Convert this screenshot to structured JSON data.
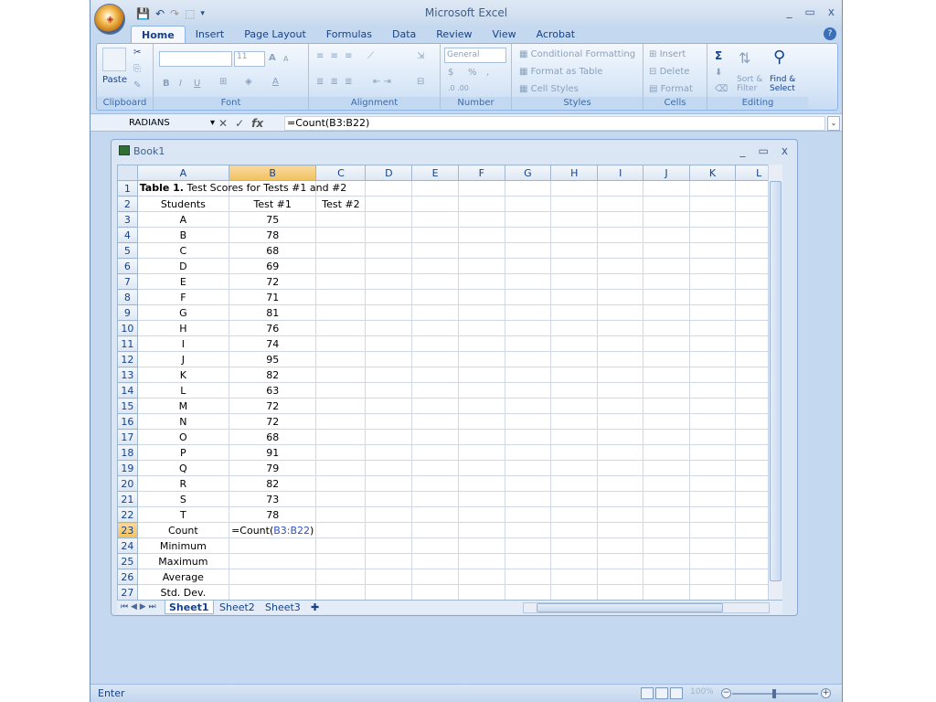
{
  "app": {
    "title": "Microsoft Excel",
    "office_button": "office-button",
    "window_controls": [
      "_",
      "▭",
      "x"
    ]
  },
  "tabs": [
    "Home",
    "Insert",
    "Page Layout",
    "Formulas",
    "Data",
    "Review",
    "View",
    "Acrobat"
  ],
  "active_tab": "Home",
  "ribbon": {
    "clipboard": {
      "label": "Clipboard",
      "paste": "Paste"
    },
    "font": {
      "label": "Font",
      "font_name": "",
      "font_size": "11",
      "grow": "A",
      "shrink": "A",
      "bold": "B",
      "italic": "I",
      "underline": "U"
    },
    "alignment": {
      "label": "Alignment"
    },
    "number": {
      "label": "Number",
      "format": "General",
      "currency": "$",
      "percent": "%",
      "comma": ","
    },
    "styles": {
      "label": "Styles",
      "conditional": "Conditional Formatting",
      "format_table": "Format as Table",
      "cell_styles": "Cell Styles"
    },
    "cells": {
      "label": "Cells",
      "insert": "Insert",
      "delete": "Delete",
      "format": "Format"
    },
    "editing": {
      "label": "Editing",
      "sigma": "Σ",
      "sort": "Sort &",
      "filter": "Filter",
      "find": "Find &",
      "select": "Select"
    }
  },
  "formula_bar": {
    "name_box": "RADIANS",
    "formula": "=Count(B3:B22)",
    "fx": "fx"
  },
  "workbook": {
    "title": "Book1",
    "controls": [
      "_",
      "▭",
      "x"
    ]
  },
  "columns": [
    "A",
    "B",
    "C",
    "D",
    "E",
    "F",
    "G",
    "H",
    "I",
    "J",
    "K",
    "L"
  ],
  "active_column": "B",
  "active_row": 23,
  "title_row": {
    "bold": "Table 1.",
    "rest": " Test Scores for Tests #1 and #2"
  },
  "headers": {
    "students": "Students",
    "test1": "Test #1",
    "test2": "Test #2"
  },
  "rows": [
    {
      "num": 3,
      "student": "A",
      "score": "75"
    },
    {
      "num": 4,
      "student": "B",
      "score": "78"
    },
    {
      "num": 5,
      "student": "C",
      "score": "68"
    },
    {
      "num": 6,
      "student": "D",
      "score": "69"
    },
    {
      "num": 7,
      "student": "E",
      "score": "72"
    },
    {
      "num": 8,
      "student": "F",
      "score": "71"
    },
    {
      "num": 9,
      "student": "G",
      "score": "81"
    },
    {
      "num": 10,
      "student": "H",
      "score": "76"
    },
    {
      "num": 11,
      "student": "I",
      "score": "74"
    },
    {
      "num": 12,
      "student": "J",
      "score": "95"
    },
    {
      "num": 13,
      "student": "K",
      "score": "82"
    },
    {
      "num": 14,
      "student": "L",
      "score": "63"
    },
    {
      "num": 15,
      "student": "M",
      "score": "72"
    },
    {
      "num": 16,
      "student": "N",
      "score": "72"
    },
    {
      "num": 17,
      "student": "O",
      "score": "68"
    },
    {
      "num": 18,
      "student": "P",
      "score": "91"
    },
    {
      "num": 19,
      "student": "Q",
      "score": "79"
    },
    {
      "num": 20,
      "student": "R",
      "score": "82"
    },
    {
      "num": 21,
      "student": "S",
      "score": "73"
    },
    {
      "num": 22,
      "student": "T",
      "score": "78"
    }
  ],
  "summary_rows": [
    {
      "num": 23,
      "label": "Count"
    },
    {
      "num": 24,
      "label": "Minimum"
    },
    {
      "num": 25,
      "label": "Maximum"
    },
    {
      "num": 26,
      "label": "Average"
    },
    {
      "num": 27,
      "label": "Std. Dev."
    }
  ],
  "editing_cell": {
    "prefix": "=Count(",
    "ref": "B3:B22",
    "suffix": ")"
  },
  "sheet_tabs": [
    "Sheet1",
    "Sheet2",
    "Sheet3"
  ],
  "active_sheet": "Sheet1",
  "status": {
    "mode": "Enter",
    "zoom": "100%"
  }
}
